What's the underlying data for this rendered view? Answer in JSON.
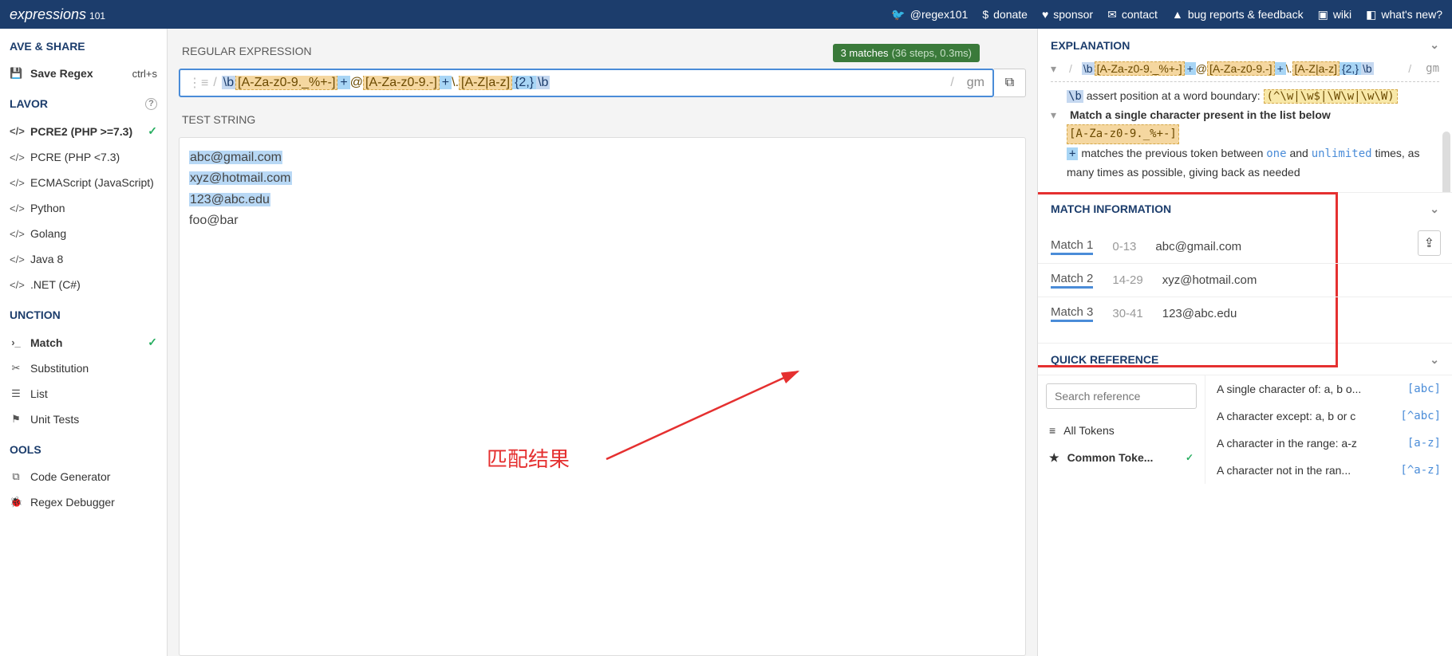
{
  "topbar": {
    "title": "expressions",
    "subtitle": "101",
    "links": [
      {
        "icon": "🐦",
        "label": "@regex101"
      },
      {
        "icon": "$",
        "label": "donate"
      },
      {
        "icon": "♥",
        "label": "sponsor"
      },
      {
        "icon": "✉",
        "label": "contact"
      },
      {
        "icon": "▲",
        "label": "bug reports & feedback"
      },
      {
        "icon": "▣",
        "label": "wiki"
      },
      {
        "icon": "◧",
        "label": "what's new?"
      }
    ]
  },
  "sidebar": {
    "save_share": "AVE & SHARE",
    "save_regex": "Save Regex",
    "save_shortcut": "ctrl+s",
    "flavor": "LAVOR",
    "flavors": [
      {
        "label": "PCRE2 (PHP >=7.3)",
        "active": true
      },
      {
        "label": "PCRE (PHP <7.3)"
      },
      {
        "label": "ECMAScript (JavaScript)"
      },
      {
        "label": "Python"
      },
      {
        "label": "Golang"
      },
      {
        "label": "Java 8"
      },
      {
        "label": ".NET (C#)"
      }
    ],
    "function": "UNCTION",
    "functions": [
      {
        "label": "Match",
        "active": true,
        "icon": "›_"
      },
      {
        "label": "Substitution",
        "icon": "✂"
      },
      {
        "label": "List",
        "icon": "☰"
      },
      {
        "label": "Unit Tests",
        "icon": "⚑"
      }
    ],
    "tools": "OOLS",
    "tools_items": [
      {
        "label": "Code Generator",
        "icon": "⧉"
      },
      {
        "label": "Regex Debugger",
        "icon": "🐞"
      }
    ]
  },
  "center": {
    "regex_label": "REGULAR EXPRESSION",
    "regex_pattern_display": "\\b[A-Za-z0-9._%+-]+@[A-Za-z0-9.-]+\\.[A-Z|a-z]{2,}\\b",
    "regex_flags": "gm",
    "matches_badge": "3 matches",
    "matches_detail": "(36 steps, 0.3ms)",
    "test_label": "TEST STRING",
    "test_lines": [
      {
        "text": "abc@gmail.com",
        "match": true
      },
      {
        "text": "xyz@hotmail.com",
        "match": true
      },
      {
        "text": "123@abc.edu",
        "match": true
      },
      {
        "text": "foo@bar",
        "match": false
      }
    ],
    "annotation_text": "匹配结果"
  },
  "right": {
    "explanation_header": "EXPLANATION",
    "expl_flags": "gm",
    "expl_lines": {
      "boundary_tok": "\\b",
      "boundary_text": "assert position at a word boundary:",
      "boundary_detail": "(^\\w|\\w$|\\W\\w|\\w\\W)",
      "match_single": "Match a single character present in the list below",
      "char_class": "[A-Za-z0-9._%+-]",
      "plus_tok": "+",
      "plus_text1": "matches the previous token between",
      "plus_one": "one",
      "plus_and": "and",
      "plus_unl": "unlimited",
      "plus_text2": "times, as many times as possible, giving back as needed"
    },
    "match_header": "MATCH INFORMATION",
    "matches": [
      {
        "label": "Match 1",
        "range": "0-13",
        "text": "abc@gmail.com"
      },
      {
        "label": "Match 2",
        "range": "14-29",
        "text": "xyz@hotmail.com"
      },
      {
        "label": "Match 3",
        "range": "30-41",
        "text": "123@abc.edu"
      }
    ],
    "quickref_header": "QUICK REFERENCE",
    "search_placeholder": "Search reference",
    "qr_left": [
      {
        "label": "All Tokens",
        "icon": "≡"
      },
      {
        "label": "Common Toke...",
        "icon": "★",
        "active": true
      }
    ],
    "qr_right": [
      {
        "label": "A single character of: a, b o...",
        "code": "[abc]"
      },
      {
        "label": "A character except: a, b or c",
        "code": "[^abc]"
      },
      {
        "label": "A character in the range: a-z",
        "code": "[a-z]"
      },
      {
        "label": "A character not in the ran...",
        "code": "[^a-z]"
      }
    ]
  }
}
